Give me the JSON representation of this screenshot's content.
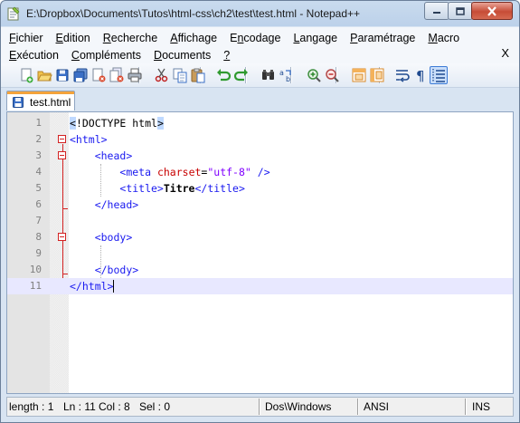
{
  "window": {
    "title": "E:\\Dropbox\\Documents\\Tutos\\html-css\\ch2\\test\\test.html - Notepad++",
    "close_doc_label": "X"
  },
  "menu": {
    "row1": [
      {
        "pre": "",
        "u": "F",
        "post": "ichier"
      },
      {
        "pre": "",
        "u": "E",
        "post": "dition"
      },
      {
        "pre": "",
        "u": "R",
        "post": "echerche"
      },
      {
        "pre": "",
        "u": "A",
        "post": "ffichage"
      },
      {
        "pre": "E",
        "u": "n",
        "post": "codage"
      },
      {
        "pre": "",
        "u": "L",
        "post": "angage"
      },
      {
        "pre": "",
        "u": "P",
        "post": "aramétrage"
      },
      {
        "pre": "",
        "u": "M",
        "post": "acro"
      }
    ],
    "row2": [
      {
        "pre": "",
        "u": "E",
        "post": "xécution"
      },
      {
        "pre": "",
        "u": "C",
        "post": "ompléments"
      },
      {
        "pre": "",
        "u": "D",
        "post": "ocuments"
      },
      {
        "pre": "",
        "u": "?",
        "post": ""
      }
    ]
  },
  "toolbar": {
    "buttons": [
      {
        "name": "new-file-icon",
        "active": false
      },
      {
        "name": "open-file-icon",
        "active": false
      },
      {
        "name": "save-icon",
        "active": false
      },
      {
        "name": "save-all-icon",
        "active": false
      },
      {
        "name": "close-file-icon",
        "active": false
      },
      {
        "name": "close-all-icon",
        "active": false
      },
      {
        "name": "print-icon",
        "active": false
      },
      {
        "name": "cut-icon",
        "active": false
      },
      {
        "name": "copy-icon",
        "active": false
      },
      {
        "name": "paste-icon",
        "active": false
      },
      {
        "name": "undo-icon",
        "active": false
      },
      {
        "name": "redo-icon",
        "active": false
      },
      {
        "name": "find-icon",
        "active": false
      },
      {
        "name": "replace-icon",
        "active": false
      },
      {
        "name": "zoom-in-icon",
        "active": false
      },
      {
        "name": "zoom-out-icon",
        "active": false
      },
      {
        "name": "sync-vertical-icon",
        "active": false
      },
      {
        "name": "sync-horizontal-icon",
        "active": false
      },
      {
        "name": "word-wrap-icon",
        "active": false
      },
      {
        "name": "show-all-chars-icon",
        "active": false
      },
      {
        "name": "indent-guide-icon",
        "active": true
      }
    ]
  },
  "tab": {
    "label": "test.html"
  },
  "editor": {
    "line_numbers": [
      "1",
      "2",
      "3",
      "4",
      "5",
      "6",
      "7",
      "8",
      "9",
      "10",
      "11"
    ],
    "current_line": 11
  },
  "status": {
    "length": "length : 1",
    "ln": "Ln : 11",
    "col": "Col : 8",
    "sel": "Sel : 0",
    "eol": "Dos\\Windows",
    "encoding": "ANSI",
    "mode": "INS"
  },
  "colors": {
    "tag": "#1a1af0",
    "attribute": "#c80000",
    "string": "#8000ff",
    "fold_marker": "#d32222",
    "current_line": "#e8e8ff",
    "tab_accent": "#f4a33b"
  }
}
